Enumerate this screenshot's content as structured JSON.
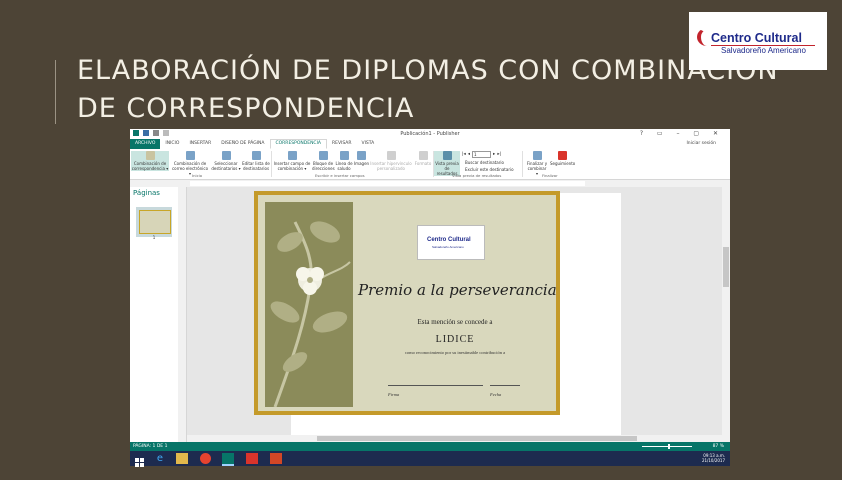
{
  "slide": {
    "title_line1": "ELABORACIÓN DE DIPLOMAS CON COMBINACIÓN",
    "title_line2": "DE CORRESPONDENCIA",
    "logo_top": "Centro Cultural",
    "logo_bottom": "Salvadoreño Americano"
  },
  "window": {
    "title": "Publicación1 - Publisher",
    "controls": "?  ▭  –  ▢  ✕",
    "signin": "Iniciar sesión",
    "tabs": [
      "ARCHIVO",
      "INICIO",
      "INSERTAR",
      "DISEÑO DE PÁGINA",
      "CORRESPONDENCIA",
      "REVISAR",
      "VISTA"
    ],
    "ribbon": {
      "b1": "Combinación de correspondencia ▾",
      "b2": "Combinación de correo electrónico ▾",
      "b3": "Seleccionar destinatarios ▾",
      "b4": "Editar lista de destinatarios",
      "b5": "Insertar campo de combinación ▾",
      "b6": "Bloque de direcciones",
      "b7": "Línea de saludo",
      "b8": "Imagen",
      "b9": "Insertar hipervínculo personalizado",
      "b10": "Formato",
      "b11": "Vista previa de resultados",
      "b12": "Finalizar y combinar ▾",
      "b13": "Seguimiento",
      "nav_value": "1",
      "find": "Buscar destinatario",
      "exclude": "Excluir este destinatario",
      "g1": "Inicio",
      "g2": "Escribir e insertar campos",
      "g3": "Vista previa de resultados",
      "g4": "Finalizar"
    },
    "pages_panel": {
      "title": "Páginas",
      "thumb_num": "1"
    },
    "diploma": {
      "logo_top": "Centro Cultural",
      "logo_bottom": "Salvadoreño Americano",
      "award": "Premio a la perseverancia",
      "mention": "Esta mención se concede a",
      "recipient": "LIDICE",
      "reason": "como reconocimiento por su inestimable contribución a",
      "sign_label": "Firma",
      "date_label": "Fecha"
    },
    "status": {
      "page": "PÁGINA: 1 DE 1",
      "zoom": "87 %"
    },
    "taskbar": {
      "time": "09:13 a.m.",
      "date": "21/10/2017"
    }
  },
  "colors": {
    "background": "#4d4436",
    "publisher_accent": "#077568",
    "taskbar": "#1d2b4f",
    "diploma_frame": "#c49a2a",
    "diploma_fill": "#d9d8bd",
    "floral_panel": "#8b8b5a"
  }
}
